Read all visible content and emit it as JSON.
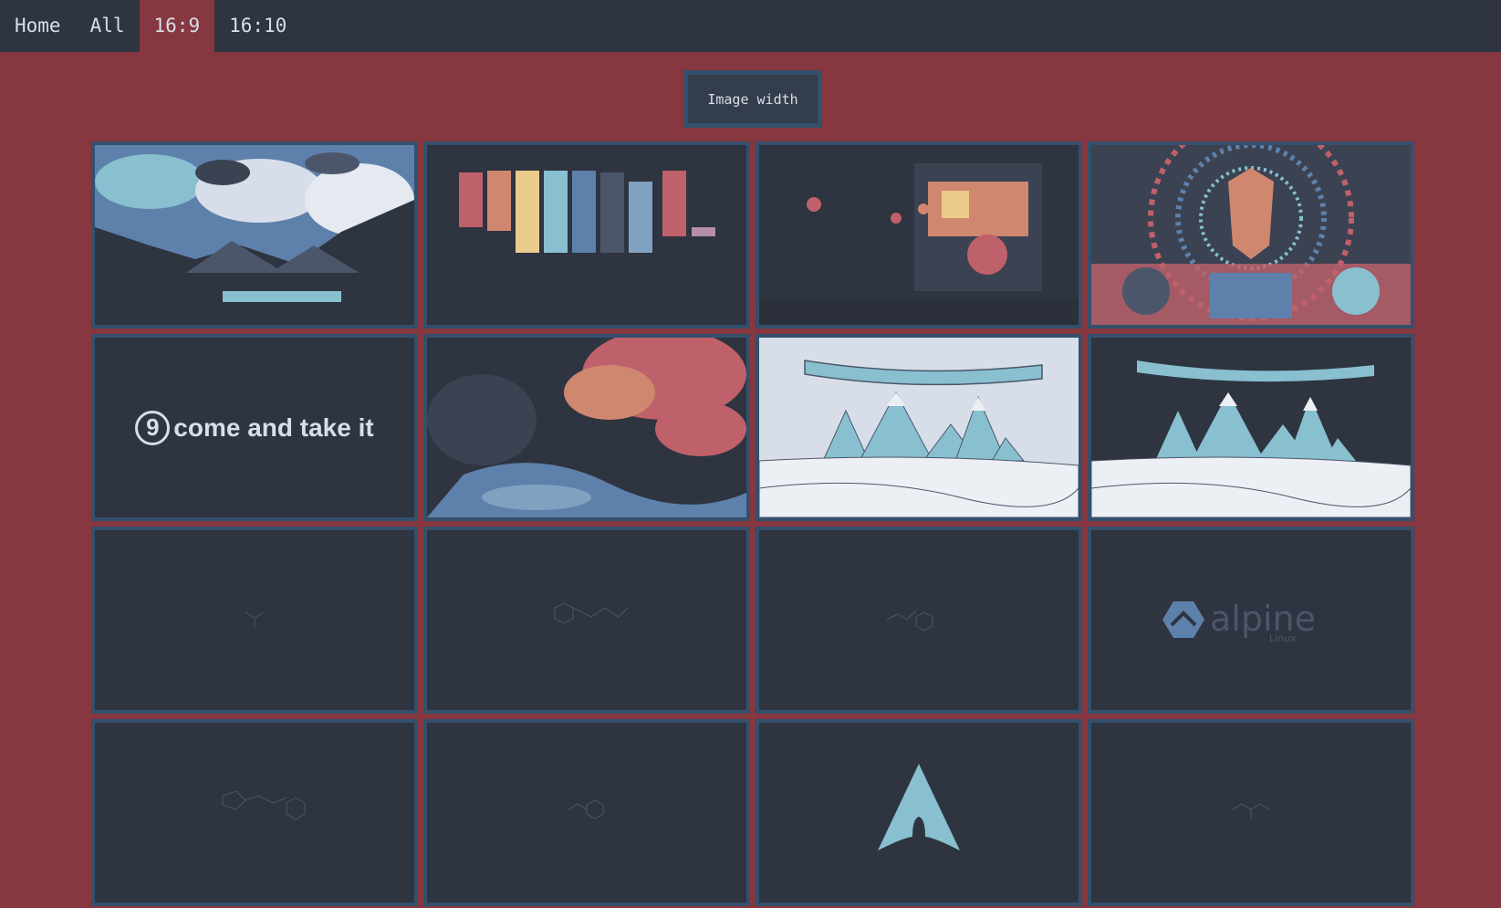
{
  "nav": {
    "tabs": [
      {
        "label": "Home",
        "active": false
      },
      {
        "label": "All",
        "active": false
      },
      {
        "label": "16:9",
        "active": true
      },
      {
        "label": "16:10",
        "active": false
      }
    ]
  },
  "controls": {
    "image_width_label": "Image width"
  },
  "colors": {
    "background": "#86373f",
    "nav": "#2e3440",
    "tile_border": "#34506c",
    "tile_bg": "#2e3440",
    "text": "#d8dee9"
  },
  "wallpapers": [
    {
      "subject": "mountain-lake-clouds"
    },
    {
      "subject": "sunset-strips"
    },
    {
      "subject": "raccoon-street-food-stall"
    },
    {
      "subject": "wolf-dj-psychedelic"
    },
    {
      "subject": "come-and-take-it",
      "text": "come and take it",
      "glyph": "9"
    },
    {
      "subject": "autumn-forest-stream"
    },
    {
      "subject": "aurora-mountains-light"
    },
    {
      "subject": "aurora-mountains-dark"
    },
    {
      "subject": "molecule-small"
    },
    {
      "subject": "molecule-chain"
    },
    {
      "subject": "molecule-dopamine"
    },
    {
      "subject": "alpine-linux-logo",
      "text": "alpine",
      "subtext": "Linux"
    },
    {
      "subject": "molecule-amoxicillin"
    },
    {
      "subject": "molecule-phenethylamine"
    },
    {
      "subject": "arch-linux-logo"
    },
    {
      "subject": "molecule-amino-acid"
    }
  ]
}
